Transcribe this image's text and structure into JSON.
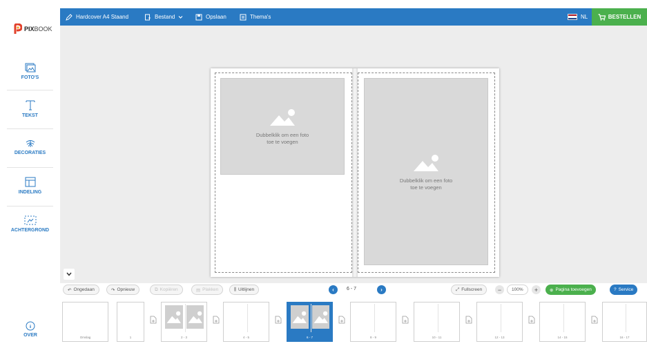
{
  "app": {
    "logo_brand": "PIX",
    "logo_rest": "BOOK"
  },
  "topbar": {
    "product": "Hardcover A4 Staand",
    "file_menu": "Bestand",
    "save": "Opslaan",
    "themes": "Thema's",
    "language": "NL",
    "order": "BESTELLEN"
  },
  "sidebar": {
    "items": [
      {
        "label": "FOTO'S",
        "icon": "photos-icon"
      },
      {
        "label": "TEKST",
        "icon": "text-icon"
      },
      {
        "label": "DECORATIES",
        "icon": "decorations-icon"
      },
      {
        "label": "INDELING",
        "icon": "layout-icon"
      },
      {
        "label": "ACHTERGROND",
        "icon": "background-icon"
      }
    ],
    "over": "OVER"
  },
  "canvas": {
    "placeholder_line1": "Dubbelklik om een foto",
    "placeholder_line2": "toe te voegen"
  },
  "toolbar": {
    "undo": "Ongedaan",
    "redo": "Opnieuw",
    "copy": "Kopiëren",
    "paste": "Plakken",
    "align": "Uitlijnen",
    "current_pages": "6 - 7",
    "fullscreen": "Fullscreen",
    "zoom": "100%",
    "add_page": "Pagina toevoegen",
    "service": "Service"
  },
  "pages": [
    "Omslag",
    "1",
    "2 - 3",
    "4 - 5",
    "6 - 7",
    "8 - 9",
    "10 - 11",
    "12 - 13",
    "14 - 15",
    "16 - 17"
  ],
  "selected_page": "6 - 7",
  "colors": {
    "accent": "#2a7ac3",
    "order": "#4bb04d",
    "canvas": "#ededed"
  }
}
